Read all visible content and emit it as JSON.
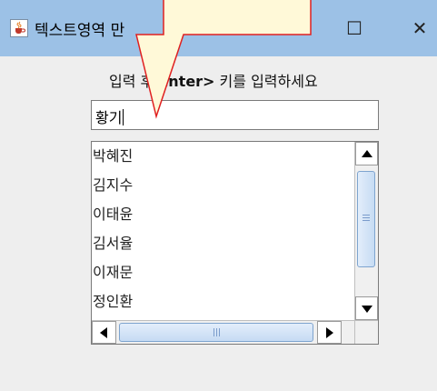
{
  "window": {
    "title": "텍스트영역 만",
    "minimize_glyph": "—",
    "maximize_glyph": "☐",
    "close_glyph": "✕",
    "icon": "java-cup-icon"
  },
  "prompt": {
    "before": "입력 후 ",
    "bold": "Enter>",
    "after": " 키를 입력하세요"
  },
  "input": {
    "value": "황기"
  },
  "list": {
    "items": [
      "박혜진",
      "김지수",
      "이태윤",
      "김서율",
      "이재문",
      "정인환"
    ]
  },
  "colors": {
    "titlebar": "#9cc1e6",
    "background": "#eeeeee",
    "callout_fill": "#fff9d8",
    "callout_stroke": "#e02020"
  }
}
